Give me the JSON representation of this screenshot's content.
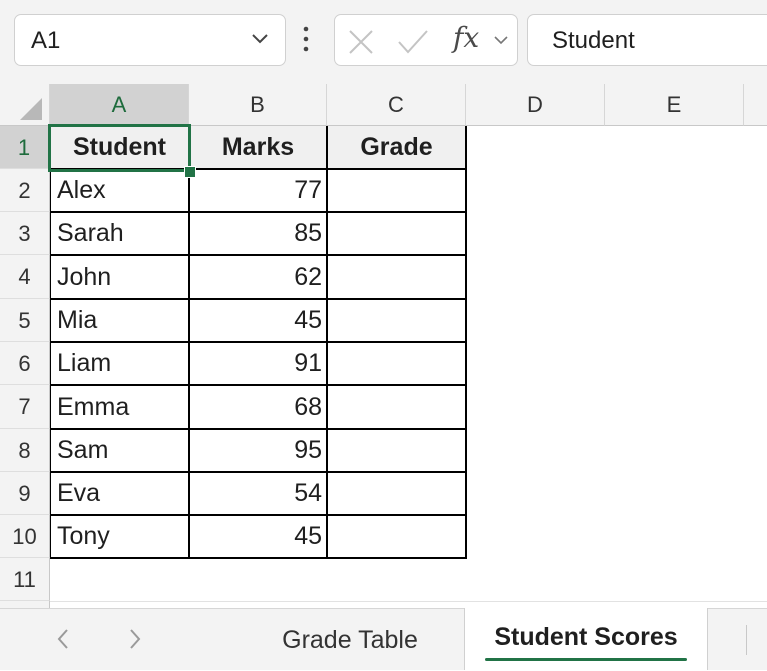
{
  "formula_bar": {
    "name_box": "A1",
    "fx_label": "fx",
    "formula_value": "Student"
  },
  "columns": [
    "A",
    "B",
    "C",
    "D",
    "E"
  ],
  "rows": [
    "1",
    "2",
    "3",
    "4",
    "5",
    "6",
    "7",
    "8",
    "9",
    "10",
    "11"
  ],
  "table": {
    "headers": [
      "Student",
      "Marks",
      "Grade"
    ],
    "rows": [
      [
        "Alex",
        "77",
        ""
      ],
      [
        "Sarah",
        "85",
        ""
      ],
      [
        "John",
        "62",
        ""
      ],
      [
        "Mia",
        "45",
        ""
      ],
      [
        "Liam",
        "91",
        ""
      ],
      [
        "Emma",
        "68",
        ""
      ],
      [
        "Sam",
        "95",
        ""
      ],
      [
        "Eva",
        "54",
        ""
      ],
      [
        "Tony",
        "45",
        ""
      ]
    ]
  },
  "sheet_tabs": {
    "tabs": [
      "Grade Table",
      "Student Scores"
    ],
    "active": "Student Scores"
  },
  "colors": {
    "accent": "#217346",
    "header_fill": "#f3f3f3",
    "selected_header_fill": "#d2d2d2"
  }
}
